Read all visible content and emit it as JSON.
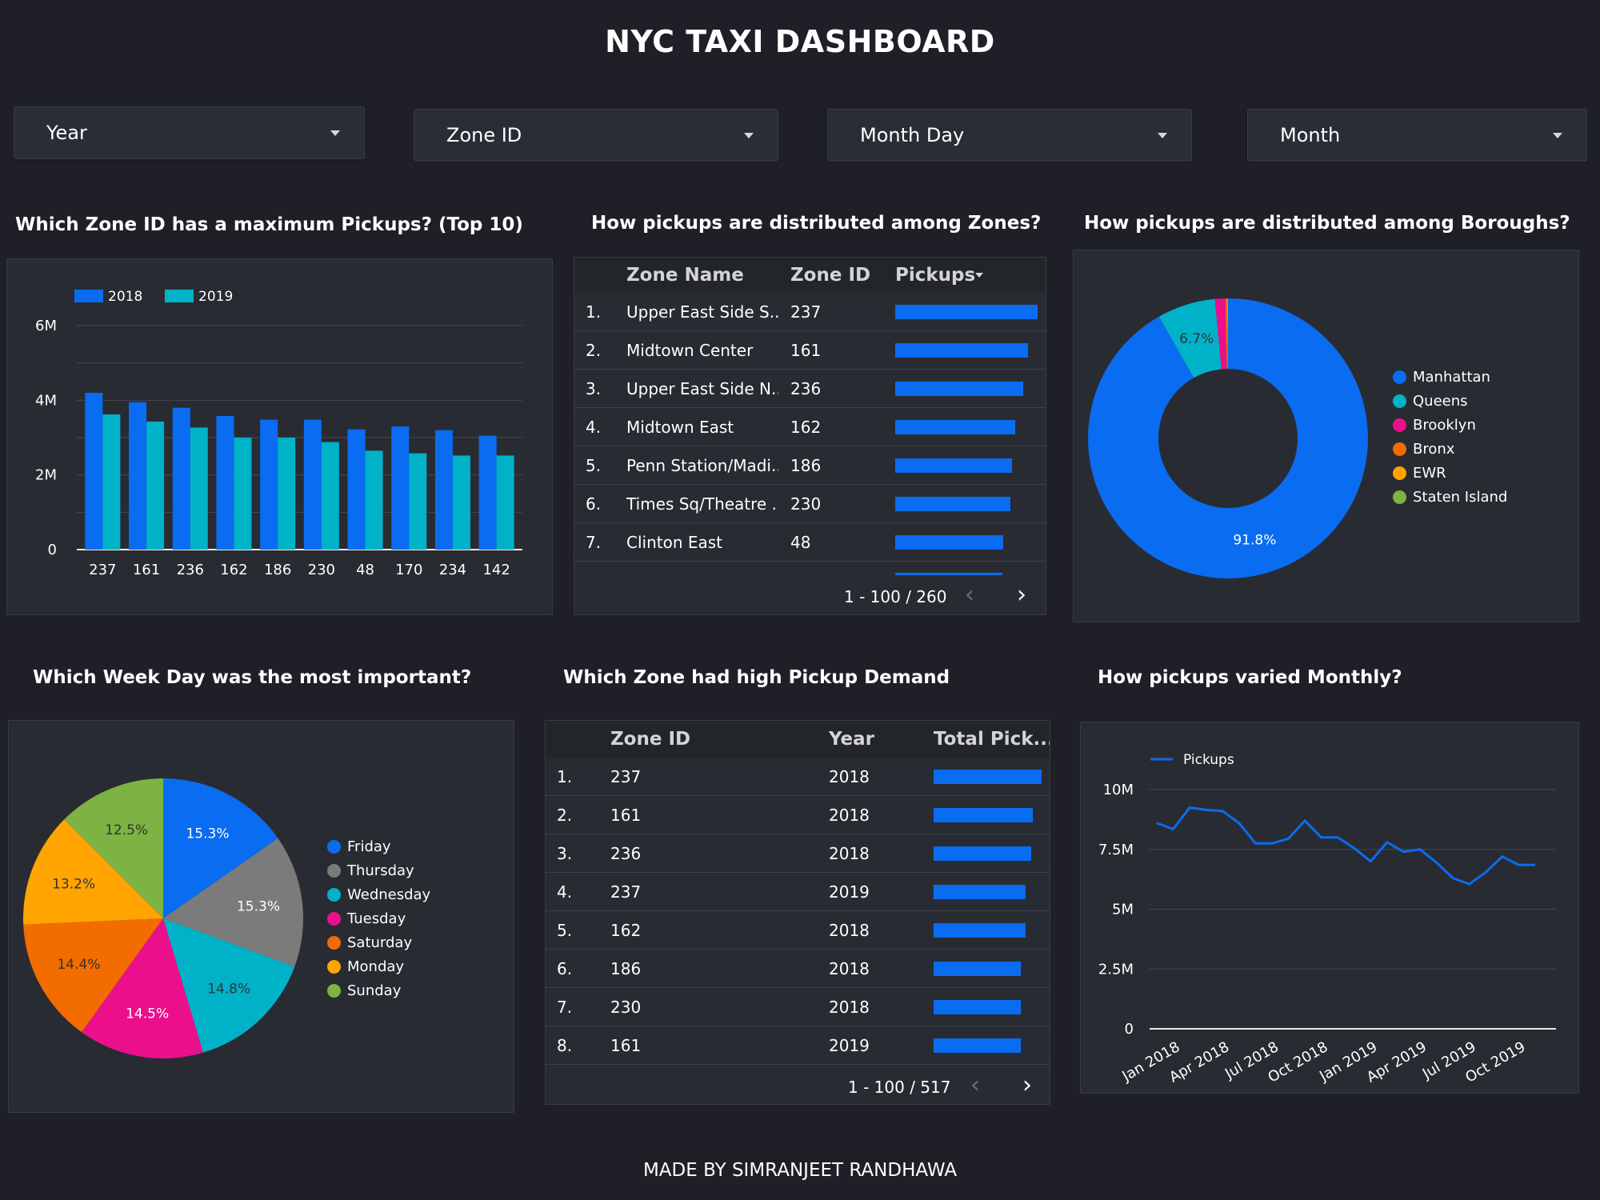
{
  "header": {
    "title": "NYC TAXI DASHBOARD"
  },
  "filters": [
    {
      "label": "Year"
    },
    {
      "label": "Zone ID"
    },
    {
      "label": "Month Day"
    },
    {
      "label": "Month"
    }
  ],
  "sections": {
    "top_zones": "Which Zone ID has a maximum Pickups? (Top 10)",
    "zone_dist": "How pickups are distributed among Zones?",
    "borough_dist": "How pickups are distributed among Boroughs?",
    "weekday": "Which Week Day was the most important?",
    "zone_demand": "Which Zone had high Pickup Demand",
    "monthly": "How pickups varied Monthly?"
  },
  "zone_table": {
    "headers": {
      "name": "Zone Name",
      "id": "Zone ID",
      "pickups": "Pickups"
    },
    "rows": [
      {
        "n": "1.",
        "name": "Upper East Side S...",
        "id": "237",
        "bar": 1.0
      },
      {
        "n": "2.",
        "name": "Midtown Center",
        "id": "161",
        "bar": 0.93
      },
      {
        "n": "3.",
        "name": "Upper East Side N...",
        "id": "236",
        "bar": 0.9
      },
      {
        "n": "4.",
        "name": "Midtown East",
        "id": "162",
        "bar": 0.84
      },
      {
        "n": "5.",
        "name": "Penn Station/Madi...",
        "id": "186",
        "bar": 0.82
      },
      {
        "n": "6.",
        "name": "Times Sq/Theatre ...",
        "id": "230",
        "bar": 0.81
      },
      {
        "n": "7.",
        "name": "Clinton East",
        "id": "48",
        "bar": 0.76
      }
    ],
    "pager": "1 - 100 / 260"
  },
  "demand_table": {
    "headers": {
      "id": "Zone ID",
      "year": "Year",
      "total": "Total Pick..."
    },
    "rows": [
      {
        "n": "1.",
        "id": "237",
        "year": "2018",
        "bar": 1.0
      },
      {
        "n": "2.",
        "id": "161",
        "year": "2018",
        "bar": 0.92
      },
      {
        "n": "3.",
        "id": "236",
        "year": "2018",
        "bar": 0.9
      },
      {
        "n": "4.",
        "id": "237",
        "year": "2019",
        "bar": 0.85
      },
      {
        "n": "5.",
        "id": "162",
        "year": "2018",
        "bar": 0.85
      },
      {
        "n": "6.",
        "id": "186",
        "year": "2018",
        "bar": 0.81
      },
      {
        "n": "7.",
        "id": "230",
        "year": "2018",
        "bar": 0.81
      },
      {
        "n": "8.",
        "id": "161",
        "year": "2019",
        "bar": 0.81
      }
    ],
    "pager": "1 - 100 / 517"
  },
  "footer": {
    "text": "MADE BY SIMRANJEET RANDHAWA"
  },
  "colors": {
    "blue": "#0a6cf0",
    "teal": "#00b2c8",
    "gray": "#7b7b7b",
    "pink": "#ec0f8c",
    "orange": "#f36c00",
    "yellow": "#ffa400",
    "green": "#7cb342"
  },
  "chart_data": [
    {
      "type": "bar",
      "categories": [
        "237",
        "161",
        "236",
        "162",
        "186",
        "230",
        "48",
        "170",
        "234",
        "142"
      ],
      "series": [
        {
          "name": "2018",
          "color": "#0a6cf0",
          "values": [
            4.2,
            3.95,
            3.8,
            3.58,
            3.48,
            3.48,
            3.22,
            3.3,
            3.2,
            3.05
          ]
        },
        {
          "name": "2019",
          "color": "#00b2c8",
          "values": [
            3.62,
            3.43,
            3.27,
            3.0,
            3.0,
            2.88,
            2.65,
            2.58,
            2.52,
            2.52
          ]
        }
      ],
      "yticks": [
        "0",
        "2M",
        "4M",
        "6M"
      ],
      "ylim": [
        0,
        6
      ],
      "legend": "top-left"
    },
    {
      "type": "pie",
      "donut": true,
      "labels": [
        "Manhattan",
        "Queens",
        "Brooklyn",
        "Bronx",
        "EWR",
        "Staten Island"
      ],
      "values": [
        91.8,
        6.7,
        1.2,
        0.2,
        0.05,
        0.05
      ],
      "label_texts": [
        "91.8%",
        "6.7%",
        "",
        "",
        "",
        ""
      ],
      "colors": [
        "#0a6cf0",
        "#00b2c8",
        "#ec0f8c",
        "#f36c00",
        "#ffa400",
        "#7cb342"
      ],
      "legend": "right"
    },
    {
      "type": "pie",
      "labels": [
        "Friday",
        "Thursday",
        "Wednesday",
        "Tuesday",
        "Saturday",
        "Monday",
        "Sunday"
      ],
      "values": [
        15.3,
        15.3,
        14.8,
        14.5,
        14.4,
        13.2,
        12.5
      ],
      "label_texts": [
        "15.3%",
        "15.3%",
        "14.8%",
        "14.5%",
        "14.4%",
        "13.2%",
        "12.5%"
      ],
      "colors": [
        "#0a6cf0",
        "#7b7b7b",
        "#00b2c8",
        "#ec0f8c",
        "#f36c00",
        "#ffa400",
        "#7cb342"
      ],
      "legend": "right"
    },
    {
      "type": "line",
      "series": [
        {
          "name": "Pickups",
          "color": "#0a6cf0",
          "values": [
            8.6,
            8.35,
            9.25,
            9.15,
            9.1,
            8.6,
            7.75,
            7.75,
            7.95,
            8.7,
            8.0,
            8.0,
            7.55,
            7.0,
            7.8,
            7.4,
            7.5,
            6.95,
            6.3,
            6.05,
            6.55,
            7.2,
            6.85,
            6.85
          ]
        }
      ],
      "x": [
        "Jan 2018",
        "Feb 2018",
        "Mar 2018",
        "Apr 2018",
        "May 2018",
        "Jun 2018",
        "Jul 2018",
        "Aug 2018",
        "Sep 2018",
        "Oct 2018",
        "Nov 2018",
        "Dec 2018",
        "Jan 2019",
        "Feb 2019",
        "Mar 2019",
        "Apr 2019",
        "May 2019",
        "Jun 2019",
        "Jul 2019",
        "Aug 2019",
        "Sep 2019",
        "Oct 2019",
        "Nov 2019",
        "Dec 2019"
      ],
      "xtick_labels": [
        "Jan 2018",
        "Apr 2018",
        "Jul 2018",
        "Oct 2018",
        "Jan 2019",
        "Apr 2019",
        "Jul 2019",
        "Oct 2019"
      ],
      "yticks": [
        "0",
        "2.5M",
        "5M",
        "7.5M",
        "10M"
      ],
      "ylim": [
        0,
        10
      ],
      "legend": "top-left"
    }
  ]
}
